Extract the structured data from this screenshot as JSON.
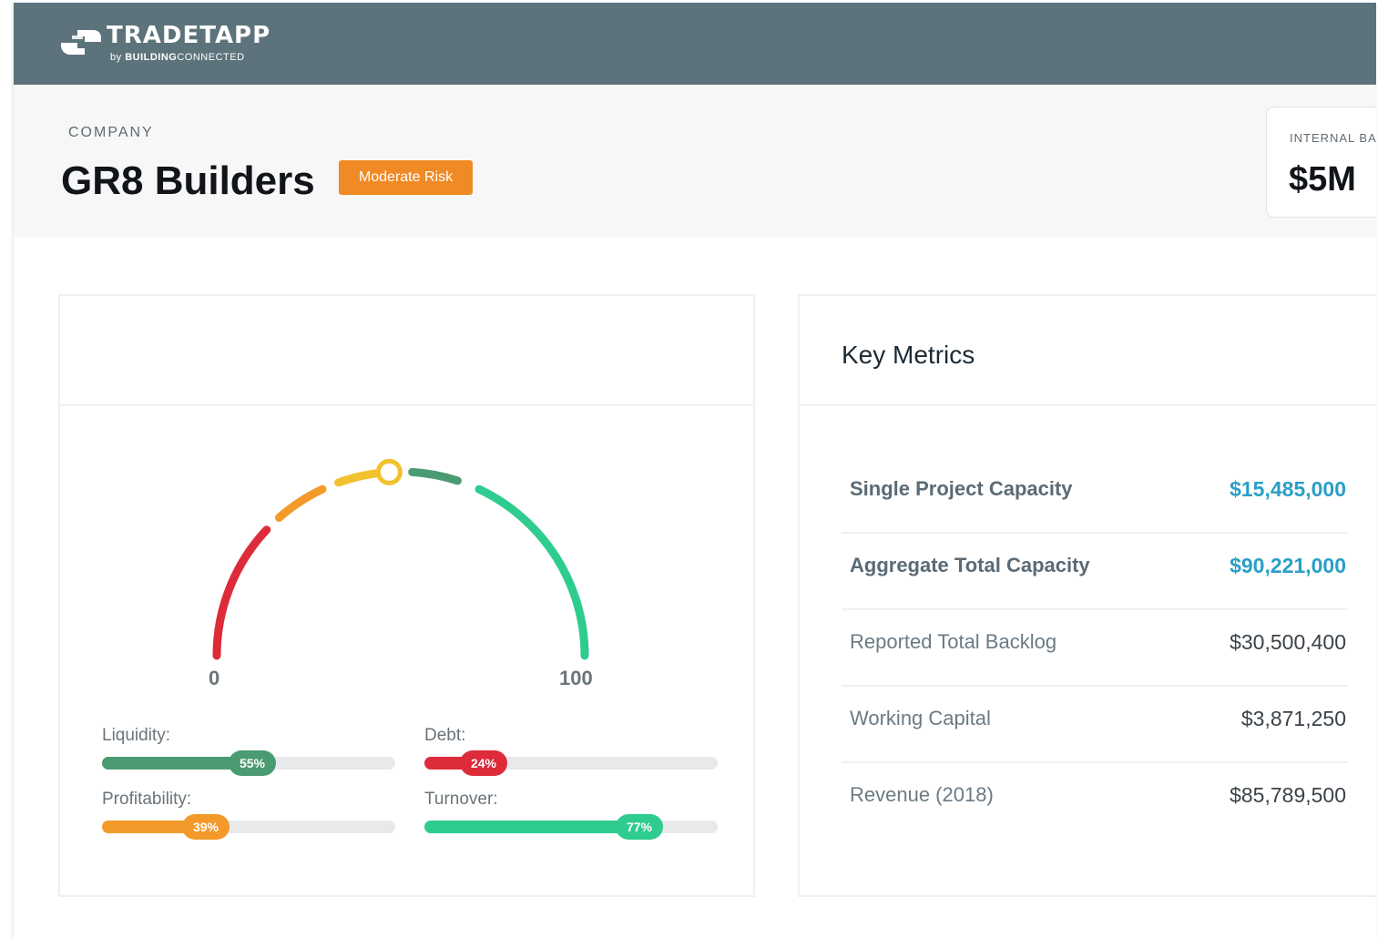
{
  "app": {
    "logo_name": "TRADETAPP",
    "logo_by": "by",
    "logo_brand_bold": "BUILDING",
    "logo_brand_light": "CONNECTED"
  },
  "colors": {
    "navbar": "#5c737c",
    "badge_orange": "#f08a24",
    "accent_blue": "#2a9fc7",
    "green": "#2ecc8f",
    "dark_green": "#4a9b72",
    "red": "#dd2b3a",
    "orange": "#f39a2b",
    "yellow": "#f2c12e"
  },
  "header": {
    "company_label": "COMPANY",
    "company_name": "GR8 Builders",
    "risk_badge": "Moderate Risk",
    "balance_label": "INTERNAL BALANCE",
    "balance_value": "$5M"
  },
  "gauge": {
    "min_label": "0",
    "max_label": "100",
    "value": 48,
    "segments": [
      {
        "from": 0,
        "to": 24,
        "color": "#dd2b3a",
        "icon": "gauge-segment"
      },
      {
        "from": 27,
        "to": 36,
        "color": "#f39a2b",
        "icon": "gauge-segment"
      },
      {
        "from": 39,
        "to": 47,
        "color": "#f2c12e",
        "icon": "gauge-segment"
      },
      {
        "from": 52,
        "to": 60,
        "color": "#4a9b72",
        "icon": "gauge-segment"
      },
      {
        "from": 64,
        "to": 100,
        "color": "#2ecc8f",
        "icon": "gauge-segment"
      }
    ],
    "bars": [
      {
        "key": "liquidity",
        "label": "Liquidity:",
        "value": 55,
        "text": "55%",
        "color": "#4a9b72"
      },
      {
        "key": "debt",
        "label": "Debt:",
        "value": 24,
        "text": "24%",
        "color": "#dd2b3a"
      },
      {
        "key": "profitability",
        "label": "Profitability:",
        "value": 39,
        "text": "39%",
        "color": "#f39a2b"
      },
      {
        "key": "turnover",
        "label": "Turnover:",
        "value": 77,
        "text": "77%",
        "color": "#2ecc8f"
      }
    ]
  },
  "key_metrics": {
    "title": "Key Metrics",
    "rows": [
      {
        "label": "Single Project Capacity",
        "value": "$15,485,000"
      },
      {
        "label": "Aggregate Total Capacity",
        "value": "$90,221,000"
      },
      {
        "label": "Reported Total Backlog",
        "value": "$30,500,400"
      },
      {
        "label": "Working Capital",
        "value": "$3,871,250"
      },
      {
        "label": "Revenue (2018)",
        "value": "$85,789,500"
      }
    ]
  }
}
